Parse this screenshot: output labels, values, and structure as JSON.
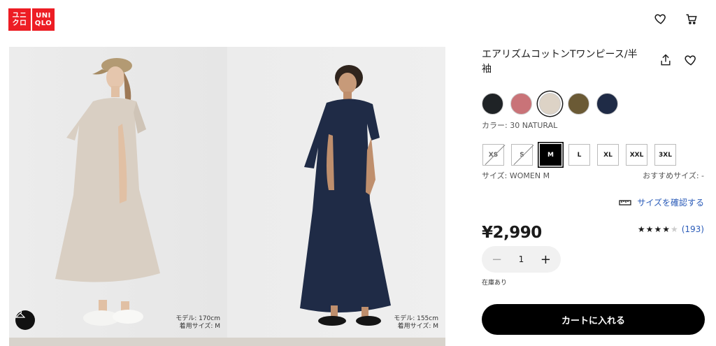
{
  "header": {
    "logo": {
      "top_left": "ユニ",
      "bottom_left": "クロ",
      "top_right": "UNI",
      "bottom_right": "QLO",
      "color": "#ed1d24"
    },
    "wishlist_icon": "heart-icon",
    "cart_icon": "cart-icon"
  },
  "gallery": {
    "left_photo": {
      "caption_line1": "モデル: 170cm",
      "caption_line2": "着用サイズ: M"
    },
    "right_photo": {
      "caption_line1": "モデル: 155cm",
      "caption_line2": "着用サイズ: M"
    },
    "hanger_icon": "hanger-icon"
  },
  "product": {
    "title": "エアリズムコットンTワンピース/半袖",
    "share_icon": "share-icon",
    "favorite_icon": "heart-icon",
    "colors": [
      {
        "name": "black",
        "hex": "#1f2326",
        "selected": false
      },
      {
        "name": "pink",
        "hex": "#c97378",
        "selected": false
      },
      {
        "name": "natural",
        "hex": "#ddd3c6",
        "selected": true
      },
      {
        "name": "olive",
        "hex": "#6b5a35",
        "selected": false
      },
      {
        "name": "navy",
        "hex": "#1f2b46",
        "selected": false
      }
    ],
    "color_label": "カラー: 30 NATURAL",
    "sizes": [
      {
        "label": "XS",
        "available": false,
        "selected": false
      },
      {
        "label": "S",
        "available": false,
        "selected": false
      },
      {
        "label": "M",
        "available": true,
        "selected": true
      },
      {
        "label": "L",
        "available": true,
        "selected": false
      },
      {
        "label": "XL",
        "available": true,
        "selected": false
      },
      {
        "label": "XXL",
        "available": true,
        "selected": false
      },
      {
        "label": "3XL",
        "available": true,
        "selected": false
      }
    ],
    "size_label": "サイズ: WOMEN M",
    "recommend_label": "おすすめサイズ: -",
    "size_check_label": "サイズを確認する",
    "price": "¥2,990",
    "rating": {
      "stars": 4,
      "max": 5,
      "count": "(193)"
    },
    "quantity": {
      "value": "1",
      "minus": "−",
      "plus": "+"
    },
    "stock": "在庫あり",
    "add_to_cart": "カートに入れる"
  }
}
